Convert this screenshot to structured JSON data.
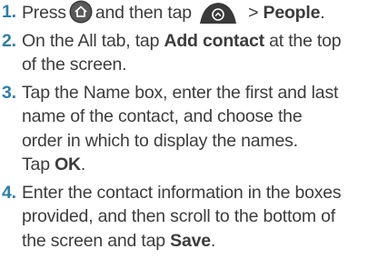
{
  "steps": [
    {
      "number": "1.",
      "text_1": "Press",
      "text_2": "and then tap",
      "text_3": " > ",
      "bold_1": "People",
      "text_4": "."
    },
    {
      "number": "2.",
      "text_1": "On the All tab, tap ",
      "bold_1": "Add contact",
      "text_2": " at the top",
      "line_2": "of the screen."
    },
    {
      "number": "3.",
      "line_1": "Tap the Name box, enter the first and last",
      "line_2": "name of the contact, and choose the",
      "line_3": "order in which to display the names.",
      "line_4_text": "Tap ",
      "bold_1": "OK",
      "line_4_end": "."
    },
    {
      "number": "4.",
      "line_1": "Enter the contact information in the boxes",
      "line_2": "provided, and then scroll to the bottom of",
      "line_3_text": "the screen and tap ",
      "bold_1": "Save",
      "line_3_end": "."
    }
  ],
  "icons": {
    "home": "home-icon",
    "all_apps": "all-apps-tab-icon"
  },
  "colors": {
    "step_number": "#2d7fa8",
    "text": "#3c3c3c",
    "button_fill": "#3a3a3a"
  }
}
